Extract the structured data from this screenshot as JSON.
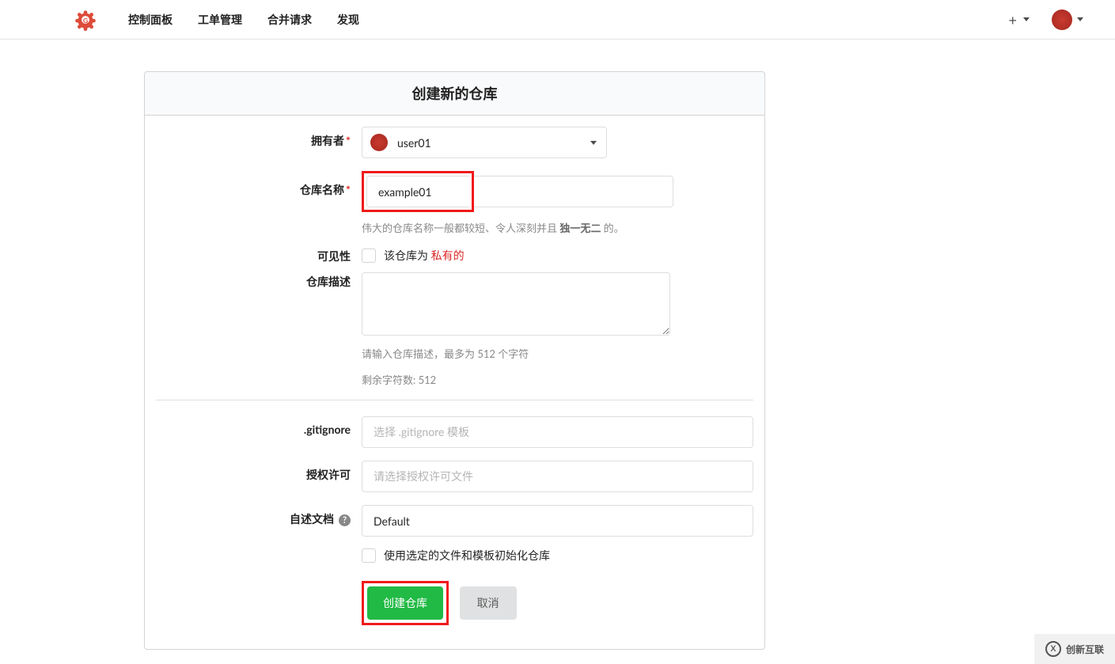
{
  "nav": {
    "links": [
      "控制面板",
      "工单管理",
      "合并请求",
      "发现"
    ]
  },
  "header": {
    "title": "创建新的仓库"
  },
  "form": {
    "owner": {
      "label": "拥有者",
      "required": "*",
      "value": "user01"
    },
    "repo_name": {
      "label": "仓库名称",
      "required": "*",
      "value": "example01",
      "help_pre": "伟大的仓库名称一般都较短、令人深刻并且 ",
      "help_bold": "独一无二",
      "help_post": " 的。"
    },
    "visibility": {
      "label": "可见性",
      "text_pre": "该仓库为 ",
      "text_red": "私有的"
    },
    "description": {
      "label": "仓库描述",
      "help1": "请输入仓库描述，最多为 512 个字符",
      "help2": "剩余字符数: 512"
    },
    "gitignore": {
      "label": ".gitignore",
      "placeholder": "选择 .gitignore 模板"
    },
    "license": {
      "label": "授权许可",
      "placeholder": "请选择授权许可文件"
    },
    "readme": {
      "label": "自述文档",
      "value": "Default",
      "init_text": "使用选定的文件和模板初始化仓库"
    },
    "buttons": {
      "submit": "创建仓库",
      "cancel": "取消"
    }
  },
  "watermark": {
    "text": "创新互联"
  }
}
